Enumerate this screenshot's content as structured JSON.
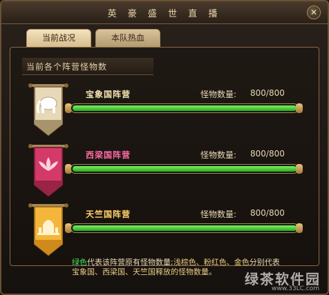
{
  "window": {
    "title": "英 豪 盛 世 直 播"
  },
  "tabs": [
    {
      "label": "当前战况",
      "active": true
    },
    {
      "label": "本队热血",
      "active": false
    }
  ],
  "section": {
    "title": "当前各个阵营怪物数"
  },
  "factions": [
    {
      "name": "宝象国阵营",
      "name_color": "#f3e3b0",
      "banner": "elephant-banner",
      "monster_label": "怪物数量:",
      "monster_value": "800/800",
      "progress": 1.0
    },
    {
      "name": "西梁国阵营",
      "name_color": "#ff6aa3",
      "banner": "lotus-banner",
      "monster_label": "怪物数量:",
      "monster_value": "800/800",
      "progress": 1.0
    },
    {
      "name": "天竺国阵营",
      "name_color": "#ffd36a",
      "banner": "palace-banner",
      "monster_label": "怪物数量:",
      "monster_value": "800/800",
      "progress": 1.0
    }
  ],
  "footer": {
    "part1": "绿色",
    "part2": "代表该阵营原有怪物数量;",
    "part3": "浅棕色、粉红色、金色",
    "part4": "分别代表",
    "line2": "宝象国、西梁国、天竺国释放的怪物数量。"
  },
  "watermark": {
    "text": "绿茶软件园",
    "url": "www.33LC.com"
  }
}
